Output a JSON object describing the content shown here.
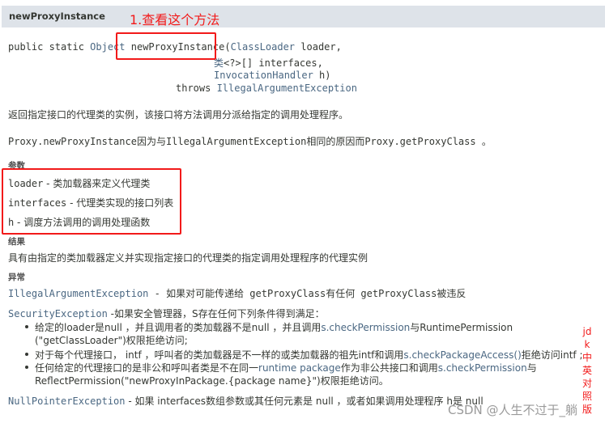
{
  "header": {
    "title": "newProxyInstance"
  },
  "annotation": {
    "step": "1.查看这个方法",
    "side_note": "jdk中英对照版",
    "box_color": "#f21a1a"
  },
  "signature": {
    "mods": "public static ",
    "ret": "Object",
    "name": " newProxyInstance(",
    "p1_type": "ClassLoader",
    "p1": " loader,",
    "p2_type": "类",
    "p2": "<?>[] interfaces,",
    "p3_type": "InvocationHandler",
    "p3": " h)",
    "throws": "throws ",
    "exc": "IllegalArgumentException"
  },
  "description": "返回指定接口的代理类的实例，该接口将方法调用分派给指定的调用处理程序。",
  "note": "Proxy.newProxyInstance因为与IllegalArgumentException相同的原因而Proxy.getProxyClass 。",
  "params": {
    "label": "参数",
    "items": [
      {
        "name": "loader",
        "desc": " - 类加载器来定义代理类"
      },
      {
        "name": "interfaces",
        "desc": " - 代理类实现的接口列表"
      },
      {
        "name": "h",
        "desc": " - 调度方法调用的调用处理函数"
      }
    ]
  },
  "result": {
    "label": "结果",
    "text": "具有由指定的类加载器定义并实现指定接口的代理类的指定调用处理程序的代理实例"
  },
  "exceptions": {
    "label": "异常",
    "illegal": {
      "name": "IllegalArgumentException",
      "text": " - 如果对可能传递给 getProxyClass有任何 getProxyClass被违反"
    },
    "security": {
      "name": "SecurityException",
      "text": " -如果安全管理器，S存在任何下列条件得到满足：",
      "b1a": "给定的loader是null ，并且调用者的类加载器不是null ，并且调用",
      "b1l": "s.checkPermission",
      "b1b": "与RuntimePermission",
      "b1c": "(\"getClassLoader\")权限拒绝访问;",
      "b2a": "对于每个代理接口， intf ，呼叫者的类加载器是不一样的或类加载器的祖先intf和调用",
      "b2l": "s.checkPackageAccess()",
      "b2b": "拒绝访问intf ;",
      "b3a": "任何给定的代理接口的是非公和呼叫者类是不在同一",
      "b3l": "runtime package",
      "b3b": "作为非公共接口和调用",
      "b3l2": "s.checkPermission",
      "b3c": "与",
      "b3d": "ReflectPermission(\"newProxyInPackage.{package name}\")权限拒绝访问。"
    },
    "npe": {
      "name": "NullPointerException",
      "text": " - 如果 interfaces数组参数或其任何元素是 null ，或者如果调用处理程序 h是 null"
    }
  },
  "watermark": "CSDN @人生不过于_躺"
}
